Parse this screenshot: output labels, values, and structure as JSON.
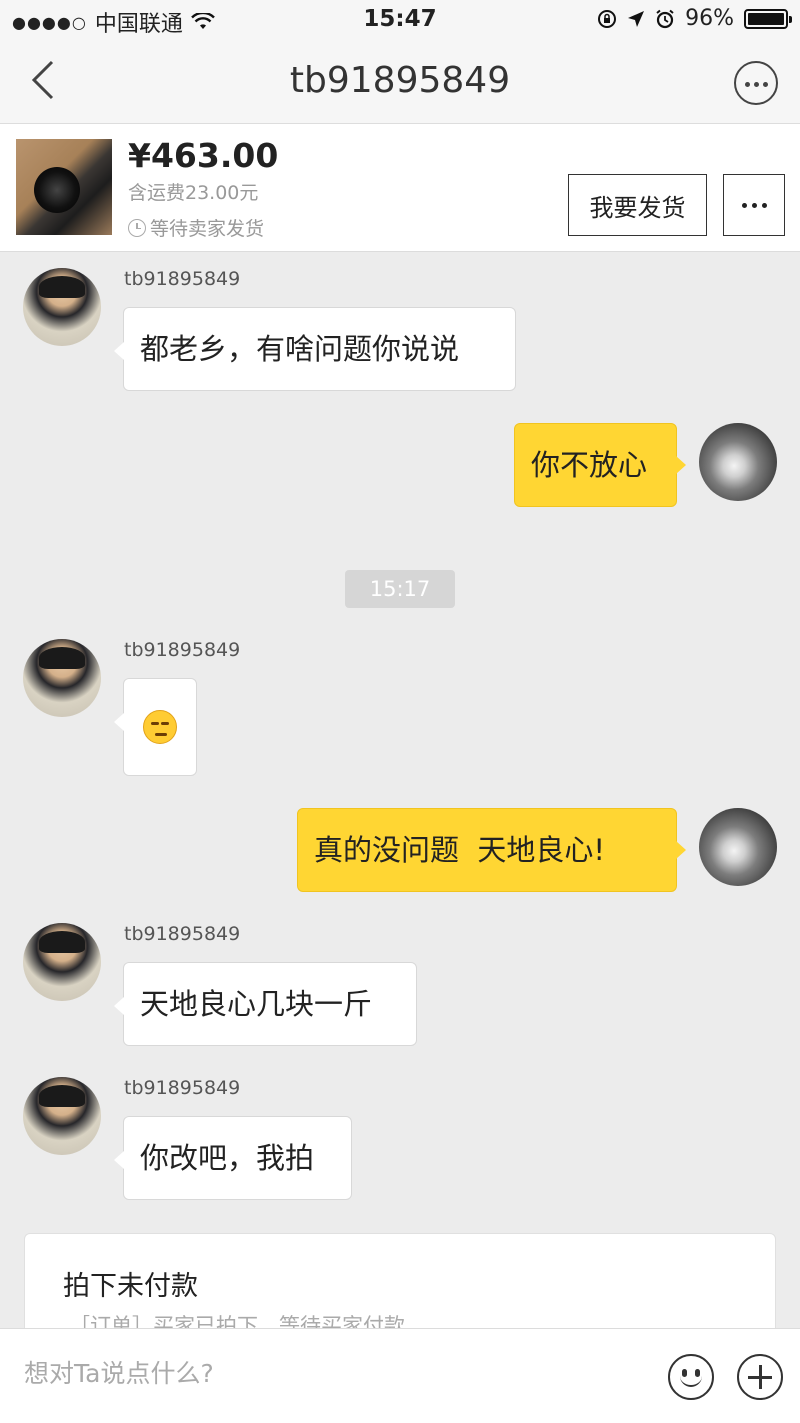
{
  "status_bar": {
    "signal_dots": "●●●●○",
    "carrier": "中国联通",
    "time": "15:47",
    "battery": "96%"
  },
  "header": {
    "title": "tb91895849"
  },
  "product": {
    "price": "¥463.00",
    "shipping": "含运费23.00元",
    "status": "等待卖家发货",
    "ship_button": "我要发货"
  },
  "messages": [
    {
      "side": "in",
      "sender": "tb91895849",
      "text": "都老乡，有啥问题你说说"
    },
    {
      "side": "out",
      "text": "你不放心"
    },
    {
      "side": "in",
      "sender": "tb91895849",
      "type": "emoji",
      "icon": "unamused-face-emoji"
    },
    {
      "side": "out",
      "text": "真的没问题  天地良心!"
    },
    {
      "side": "in",
      "sender": "tb91895849",
      "text": "天地良心几块一斤"
    },
    {
      "side": "in",
      "sender": "tb91895849",
      "text": "你改吧，我拍"
    }
  ],
  "timestamp": "15:17",
  "order_card": {
    "title": "拍下未付款",
    "description": "［订单］买家已拍下，等待买家付款"
  },
  "input": {
    "placeholder": "想对Ta说点什么?"
  },
  "colors": {
    "outgoing_bubble": "#ffd633",
    "background": "#ececec"
  }
}
